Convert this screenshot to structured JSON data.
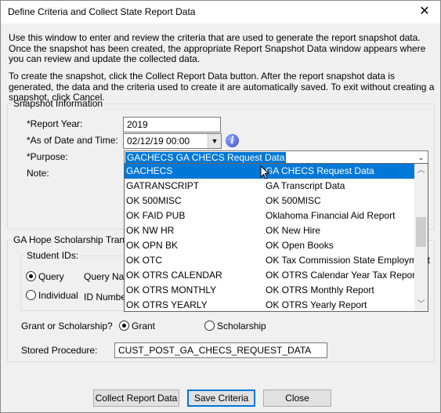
{
  "window": {
    "title": "Define Criteria and Collect State Report Data",
    "close_glyph": "✕"
  },
  "intro": {
    "p1": "Use this window to enter and review the criteria that are used to generate the report snapshot data. Once the snapshot has been created, the appropriate Report Snapshot Data window appears where you can review and update the collected data.",
    "p2": "To create the snapshot, click the Collect Report Data button. After the report snapshot data is generated, the data and the criteria used to create it are automatically saved. To exit without creating a snapshot, click Cancel."
  },
  "snapshot": {
    "legend": "Snapshot Information",
    "report_year_label": "*Report Year:",
    "report_year_value": "2019",
    "as_of_label": "*As of Date and Time:",
    "as_of_value": "02/12/19 00:00",
    "purpose_label": "*Purpose:",
    "purpose_value": "GACHECS   GA CHECS Request Data",
    "note_label": "Note:"
  },
  "purpose_dropdown": {
    "items": [
      {
        "code": "GACHECS",
        "desc": "GA CHECS Request Data",
        "selected": true
      },
      {
        "code": "GATRANSCRIPT",
        "desc": "GA Transcript Data"
      },
      {
        "code": "OK 500MISC",
        "desc": "OK 500MISC"
      },
      {
        "code": "OK FAID PUB",
        "desc": "Oklahoma Financial Aid Report"
      },
      {
        "code": "OK NW HR",
        "desc": "OK New Hire"
      },
      {
        "code": "OK OPN BK",
        "desc": "OK Open Books"
      },
      {
        "code": "OK OTC",
        "desc": "OK Tax Commission State Employment"
      },
      {
        "code": "OK OTRS CALENDAR",
        "desc": "OK OTRS Calendar Year Tax Report"
      },
      {
        "code": "OK OTRS MONTHLY",
        "desc": "OK OTRS Monthly Report"
      },
      {
        "code": "OK OTRS YEARLY",
        "desc": "OK OTRS Yearly Report"
      }
    ]
  },
  "hope": {
    "legend": "GA Hope Scholarship Transcri",
    "student_ids_legend": "Student IDs:",
    "query_label": "Query",
    "query_name_label": "Query Nam",
    "individual_label": "Individual",
    "id_number_label": "ID Number",
    "grant_question": "Grant or Scholarship?",
    "grant_label": "Grant",
    "scholarship_label": "Scholarship",
    "stored_proc_label": "Stored Procedure:",
    "stored_proc_value": "CUST_POST_GA_CHECS_REQUEST_DATA"
  },
  "buttons": {
    "collect": "Collect Report Data",
    "save": "Save Criteria",
    "close": "Close"
  },
  "colors": {
    "selection": "#0078d7"
  },
  "icons": {
    "info": "info-icon",
    "calendar_dropdown": "chevron-down-icon"
  }
}
